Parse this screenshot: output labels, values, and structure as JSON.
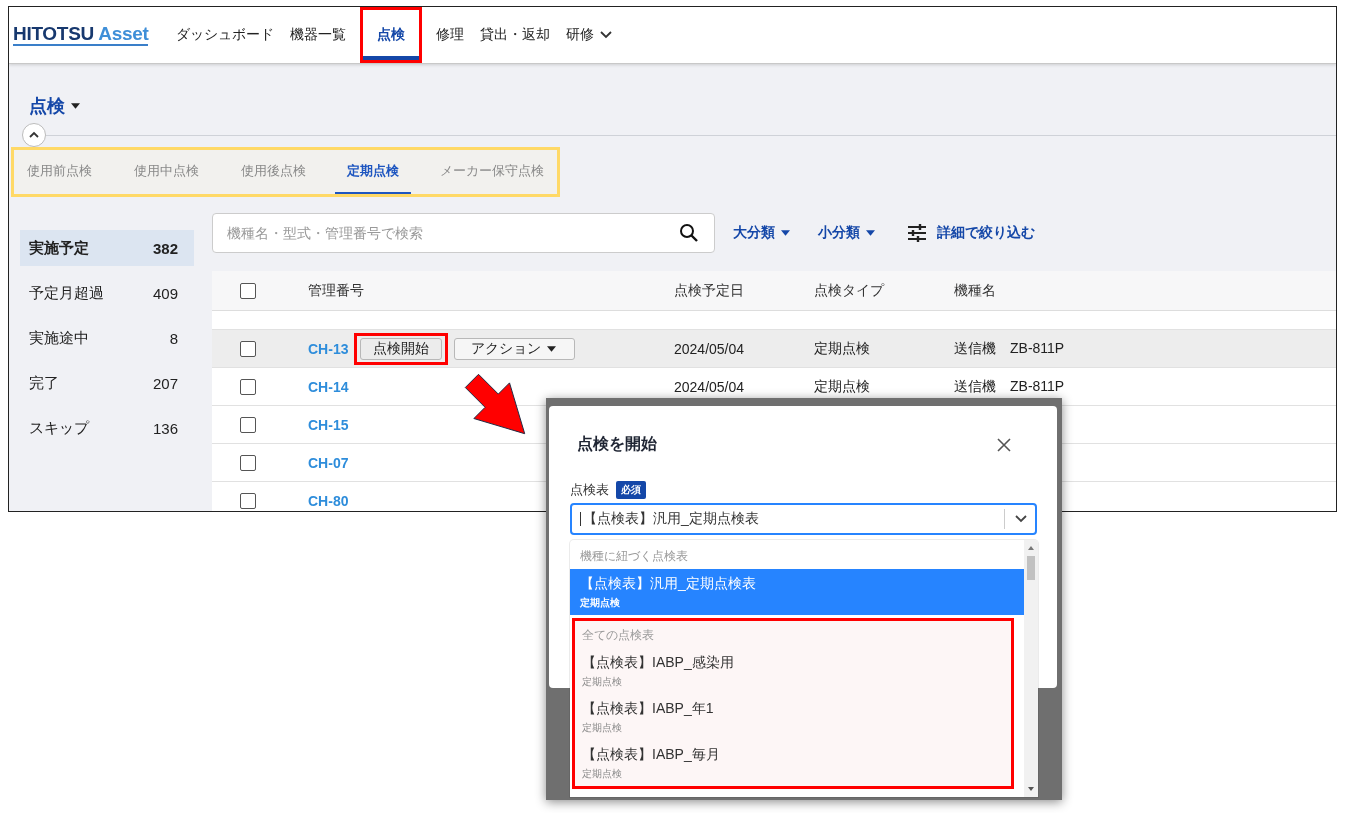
{
  "header": {
    "logo": {
      "primary": "HITOTSU",
      "secondary": "Asset"
    },
    "nav": [
      {
        "label": "ダッシュボード",
        "selected": false,
        "highlighted": false,
        "has_menu": false
      },
      {
        "label": "機器一覧",
        "selected": false,
        "highlighted": false,
        "has_menu": false
      },
      {
        "label": "点検",
        "selected": true,
        "highlighted": true,
        "has_menu": false
      },
      {
        "label": "修理",
        "selected": false,
        "highlighted": false,
        "has_menu": false
      },
      {
        "label": "貸出・返却",
        "selected": false,
        "highlighted": false,
        "has_menu": false
      },
      {
        "label": "研修",
        "selected": false,
        "highlighted": false,
        "has_menu": true
      }
    ]
  },
  "page_title": "点検",
  "tabs_highlighted": true,
  "tabs": [
    {
      "label": "使用前点検",
      "selected": false
    },
    {
      "label": "使用中点検",
      "selected": false
    },
    {
      "label": "使用後点検",
      "selected": false
    },
    {
      "label": "定期点検",
      "selected": true
    },
    {
      "label": "メーカー保守点検",
      "selected": false
    }
  ],
  "sidebar": {
    "items": [
      {
        "label": "実施予定",
        "count": "382",
        "selected": true
      },
      {
        "label": "予定月超過",
        "count": "409",
        "selected": false
      },
      {
        "label": "実施途中",
        "count": "8",
        "selected": false
      },
      {
        "label": "完了",
        "count": "207",
        "selected": false
      },
      {
        "label": "スキップ",
        "count": "136",
        "selected": false
      }
    ]
  },
  "search": {
    "placeholder": "機種名・型式・管理番号で検索"
  },
  "filters": [
    {
      "label": "大分類",
      "kind": "dropdown"
    },
    {
      "label": "小分類",
      "kind": "dropdown"
    },
    {
      "label": "詳細で絞り込む",
      "kind": "advanced"
    }
  ],
  "table": {
    "columns": [
      "管理番号",
      "点検予定日",
      "点検タイプ",
      "機種名"
    ],
    "header_checked": false,
    "rows": [
      {
        "id": "CH-13",
        "date": "2024/05/04",
        "type": "定期点検",
        "model": "送信機　ZB-811P",
        "checked": false,
        "hovered": true,
        "start_button": {
          "label": "点検開始",
          "highlighted": true
        },
        "action_button": "アクション"
      },
      {
        "id": "CH-14",
        "date": "2024/05/04",
        "type": "定期点検",
        "model": "送信機　ZB-811P",
        "checked": false,
        "hovered": false
      },
      {
        "id": "CH-15",
        "checked": false,
        "hovered": false
      },
      {
        "id": "CH-07",
        "checked": false,
        "hovered": false
      },
      {
        "id": "CH-80",
        "checked": false,
        "hovered": false
      }
    ]
  },
  "modal": {
    "title": "点検を開始",
    "field_label": "点検表",
    "required_badge": "必須",
    "value": "【点検表】汎用_定期点検表",
    "dropdown": {
      "groups": [
        {
          "label": "機種に紐づく点検表",
          "highlighted": false,
          "options": [
            {
              "title": "【点検表】汎用_定期点検表",
              "subtitle": "定期点検",
              "selected": true
            }
          ]
        },
        {
          "label": "全ての点検表",
          "highlighted": true,
          "options": [
            {
              "title": "【点検表】IABP_感染用",
              "subtitle": "定期点検",
              "selected": false
            },
            {
              "title": "【点検表】IABP_年1",
              "subtitle": "定期点検",
              "selected": false
            },
            {
              "title": "【点検表】IABP_毎月",
              "subtitle": "定期点検",
              "selected": false
            }
          ]
        }
      ]
    }
  }
}
